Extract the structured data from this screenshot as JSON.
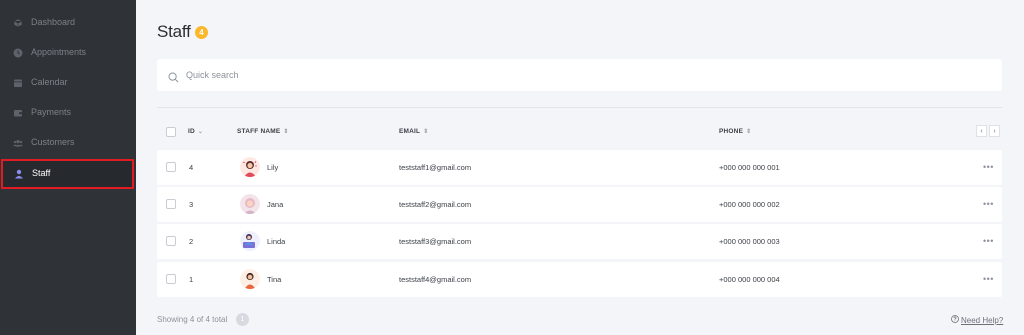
{
  "sidebar": {
    "items": [
      {
        "label": "Dashboard",
        "icon": "cube-icon"
      },
      {
        "label": "Appointments",
        "icon": "clock-icon"
      },
      {
        "label": "Calendar",
        "icon": "calendar-icon"
      },
      {
        "label": "Payments",
        "icon": "wallet-icon"
      },
      {
        "label": "Customers",
        "icon": "users-icon"
      },
      {
        "label": "Staff",
        "icon": "user-icon"
      }
    ],
    "active": "Staff"
  },
  "page": {
    "title": "Staff",
    "count": "4"
  },
  "search": {
    "placeholder": "Quick search"
  },
  "table": {
    "columns": {
      "id": "ID",
      "staff_name": "STAFF NAME",
      "email": "EMAIL",
      "phone": "PHONE"
    },
    "rows": [
      {
        "id": "4",
        "name": "Lily",
        "email": "teststaff1@gmail.com",
        "phone": "+000 000 000 001"
      },
      {
        "id": "3",
        "name": "Jana",
        "email": "teststaff2@gmail.com",
        "phone": "+000 000 000 002"
      },
      {
        "id": "2",
        "name": "Linda",
        "email": "teststaff3@gmail.com",
        "phone": "+000 000 000 003"
      },
      {
        "id": "1",
        "name": "Tina",
        "email": "teststaff4@gmail.com",
        "phone": "+000 000 000 004"
      }
    ],
    "row_menu": "•••",
    "prev": "‹",
    "next": "›"
  },
  "footer": {
    "showing": "Showing 4 of 4 total",
    "page": "1",
    "help": "Need Help?"
  },
  "colors": {
    "sidebar_bg": "#2f3236",
    "active_border": "#e11b22",
    "badge": "#fcb72b",
    "staff_icon": "#8a8cf2"
  }
}
